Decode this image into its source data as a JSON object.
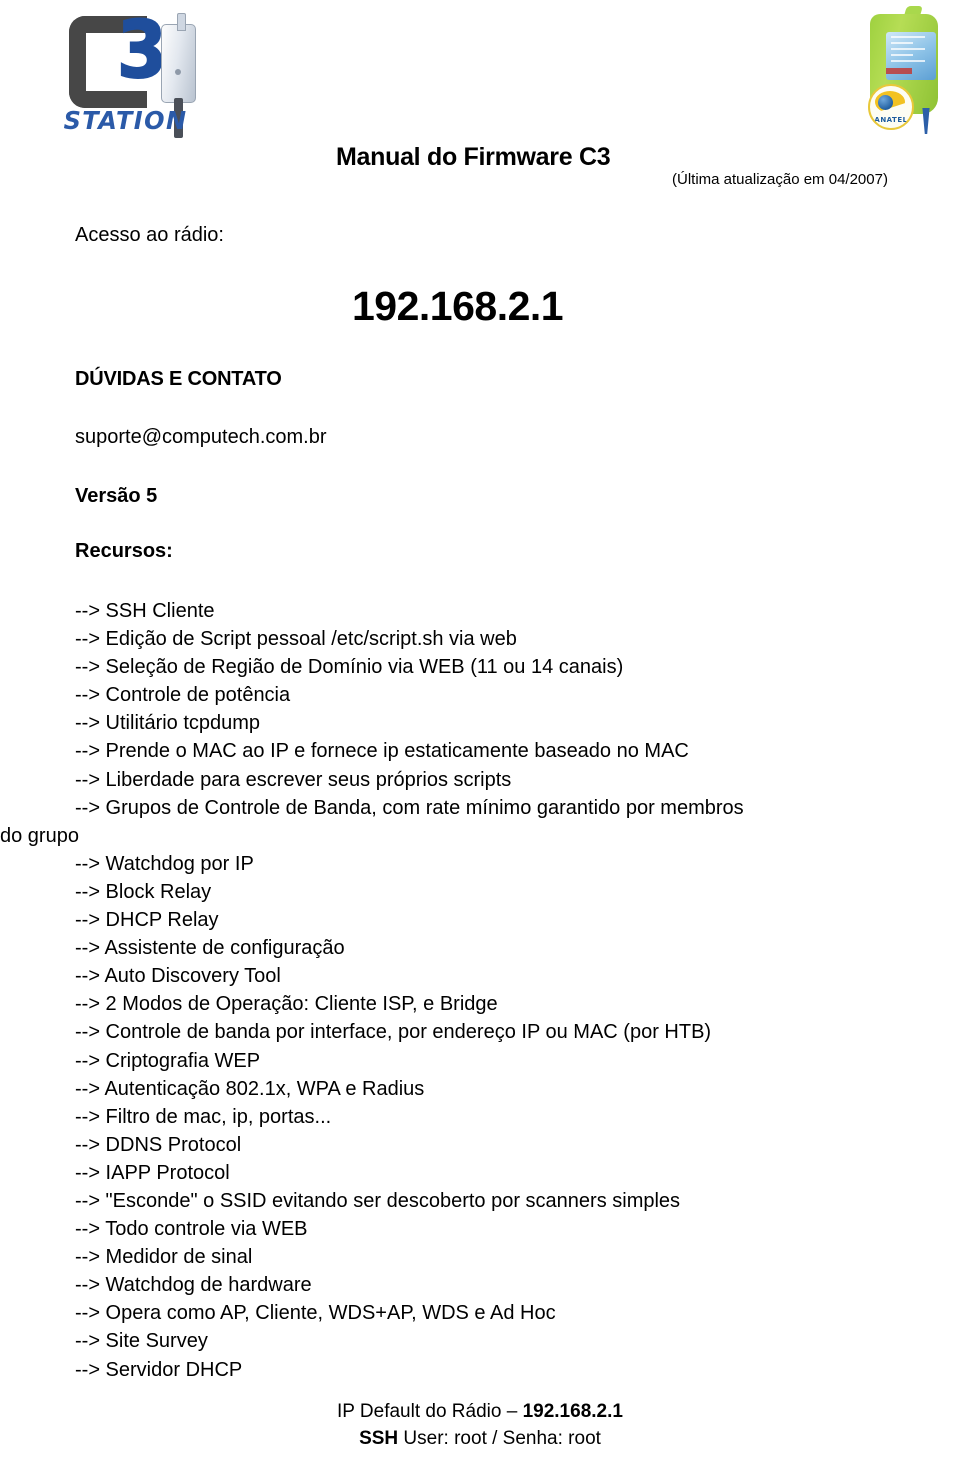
{
  "header": {
    "logo": {
      "brand_letter": "C",
      "brand_number": "3",
      "brand_word": "STATION",
      "alt": "C3 Station logo"
    },
    "product_photo": {
      "alt": "C3 Station outdoor radio unit",
      "certification_badge": "ANATEL"
    },
    "title": "Manual do Firmware C3",
    "subtitle": "(Última atualização em 04/2007)"
  },
  "access": {
    "label": "Acesso ao rádio:",
    "ip": "192.168.2.1"
  },
  "contact": {
    "heading": "DÚVIDAS E CONTATO",
    "email": "suporte@computech.com.br"
  },
  "version": "Versão 5",
  "features": {
    "heading": "Recursos:",
    "items": [
      "--> SSH Cliente",
      "--> Edição de Script pessoal /etc/script.sh via web",
      "--> Seleção de Região de Domínio via WEB (11 ou 14 canais)",
      "--> Controle de potência",
      "--> Utilitário tcpdump",
      "--> Prende o MAC ao IP e fornece ip estaticamente baseado no MAC",
      "--> Liberdade para escrever seus próprios scripts",
      "--> Grupos de Controle de Banda, com rate mínimo garantido por membros",
      "do grupo",
      "--> Watchdog por IP",
      "--> Block Relay",
      "--> DHCP Relay",
      "--> Assistente de configuração",
      "--> Auto Discovery Tool",
      "--> 2 Modos de Operação: Cliente ISP, e Bridge",
      "--> Controle de banda por interface, por endereço IP ou MAC (por HTB)",
      "--> Criptografia WEP",
      "--> Autenticação 802.1x, WPA e Radius",
      "--> Filtro de mac, ip, portas...",
      "--> DDNS Protocol",
      "--> IAPP Protocol",
      "--> \"Esconde\" o SSID evitando ser descoberto por scanners simples",
      "--> Todo controle via WEB",
      "--> Medidor de sinal",
      "--> Watchdog de hardware",
      "--> Opera como AP, Cliente, WDS+AP, WDS e Ad Hoc",
      "--> Site Survey",
      "--> Servidor DHCP"
    ]
  },
  "footer": {
    "line1_prefix": "IP Default do Rádio – ",
    "line1_ip": "192.168.2.1",
    "line2_bold": "SSH",
    "line2_rest": " User: root / Senha: root"
  },
  "colors": {
    "text": "#000000",
    "background": "#ffffff",
    "logo_blue": "#2b5aa8",
    "logo_gray": "#474747",
    "product_green": "#9ed13f",
    "anatel_yellow": "#f2c222"
  }
}
